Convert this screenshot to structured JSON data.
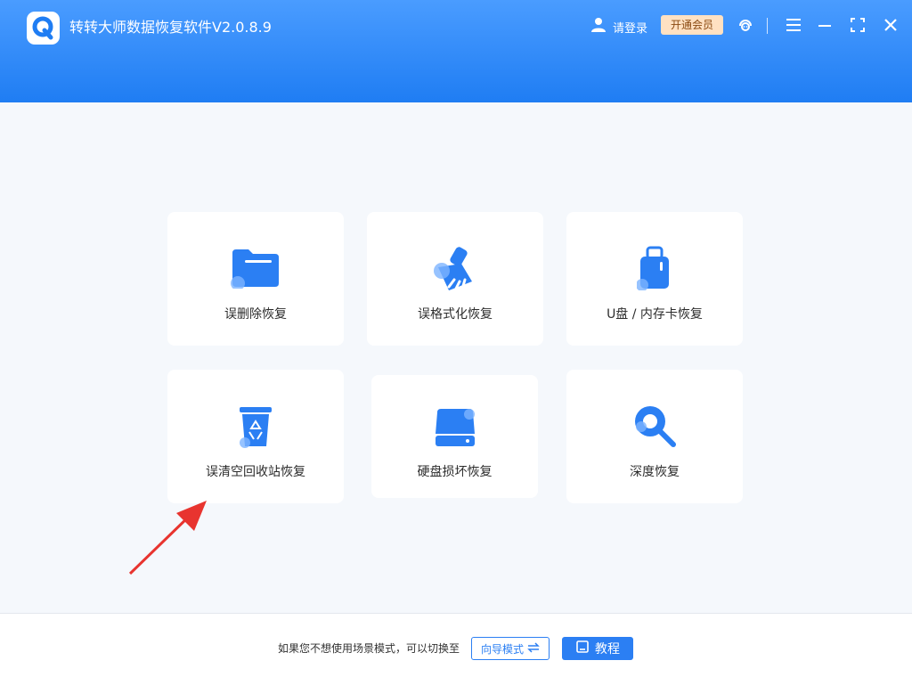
{
  "app": {
    "title": "转转大师数据恢复软件V2.0.8.9",
    "login_label": "请登录",
    "vip_label": "开通会员"
  },
  "colors": {
    "header_blue": "#1f7df3",
    "accent_blue": "#2b7ff3",
    "vip_bg": "#ffe1c2",
    "arrow_red": "#e8342f"
  },
  "header_icons": [
    "user-icon",
    "service-icon",
    "menu-icon",
    "minimize-icon",
    "fullscreen-icon",
    "close-icon"
  ],
  "cards": [
    {
      "label": "误删除恢复",
      "icon": "folder-icon"
    },
    {
      "label": "误格式化恢复",
      "icon": "broom-icon"
    },
    {
      "label": "U盘 / 内存卡恢复",
      "icon": "usb-drive-icon"
    },
    {
      "label": "误清空回收站恢复",
      "icon": "recycle-bin-icon"
    },
    {
      "label": "硬盘损坏恢复",
      "icon": "hard-drive-icon"
    },
    {
      "label": "深度恢复",
      "icon": "deep-scan-icon"
    }
  ],
  "footer": {
    "text": "如果您不想使用场景模式，可以切换至",
    "guide_label": "向导模式",
    "tutorial_label": "教程"
  }
}
